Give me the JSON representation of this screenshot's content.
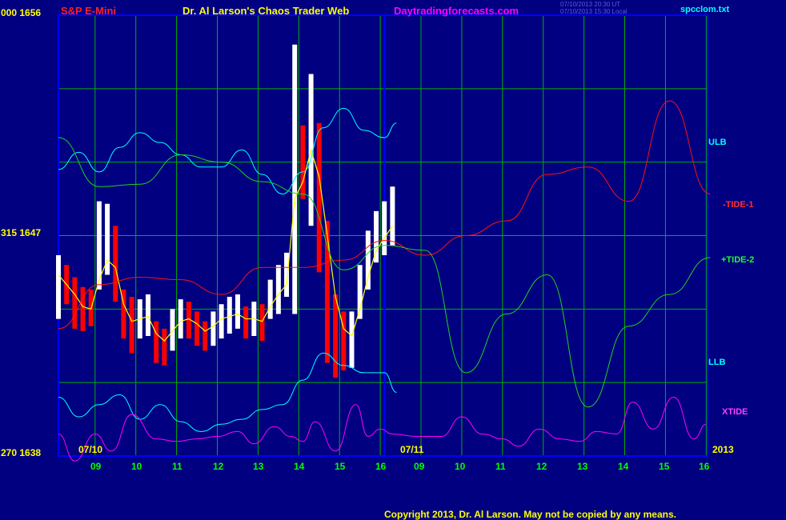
{
  "header": {
    "corner_label": "000  1656",
    "symbol": "S&P E-Mini",
    "site_title": "Dr. Al Larson's Chaos Trader Web",
    "website": "Daytradingforecasts.com",
    "timestamp_1": "07/10/2013 20:30 UT",
    "timestamp_2": "07/10/2013 15:30 Local",
    "filename": "spcclom.txt"
  },
  "footer": {
    "copyright": "Copyright 2013, Dr. Al Larson. May not be copied by any means."
  },
  "colors": {
    "background": "#000080",
    "grid": "#00b000",
    "axis": "#0000ff",
    "tide1": "#ff1010",
    "tide2": "#20d020",
    "band": "#00ffff",
    "xtide": "#ff00ff",
    "bar_up": "#ffffff",
    "bar_down": "#ff0000",
    "average": "#ffff00"
  },
  "chart_data": {
    "type": "line",
    "y_axis": {
      "ticks": [
        {
          "label": "000  1656",
          "value": 1656
        },
        {
          "label": "315  1647",
          "value": 1647
        },
        {
          "label": "270  1638",
          "value": 1638
        }
      ]
    },
    "x_axis": {
      "hour_ticks": [
        "09",
        "10",
        "11",
        "12",
        "13",
        "14",
        "15",
        "16",
        "09",
        "10",
        "11",
        "12",
        "13",
        "14",
        "15",
        "16"
      ],
      "date_labels": [
        "07/10",
        "07/11",
        "2013"
      ]
    },
    "grid": true,
    "series": [
      {
        "name": "ULB",
        "color": "#00ffff",
        "x": [
          0,
          0.5,
          1,
          1.5,
          2,
          2.5,
          3,
          3.5,
          4,
          4.5,
          5,
          5.5,
          6,
          6.5,
          7,
          7.5,
          8,
          8.3
        ],
        "y": [
          1649.7,
          1650.4,
          1649.6,
          1650.6,
          1651.2,
          1650.8,
          1650.3,
          1649.8,
          1649.8,
          1650.5,
          1649.5,
          1648.7,
          1649.6,
          1651.4,
          1652.2,
          1651.3,
          1651.0,
          1651.6
        ]
      },
      {
        "name": "LLB",
        "color": "#00ffff",
        "x": [
          0,
          0.5,
          1,
          1.5,
          2,
          2.5,
          3,
          3.5,
          4,
          4.5,
          5,
          5.5,
          6,
          6.5,
          7,
          7.5,
          8,
          8.3
        ],
        "y": [
          1640.4,
          1639.6,
          1640.1,
          1640.5,
          1639.5,
          1640.1,
          1639.4,
          1639.0,
          1639.3,
          1639.5,
          1639.9,
          1640.1,
          1641.1,
          1642.2,
          1641.7,
          1641.4,
          1641.4,
          1640.6
        ]
      },
      {
        "name": "-TIDE-1",
        "color": "#ff1010",
        "x": [
          0,
          1,
          2,
          3,
          4,
          5,
          6,
          7,
          8,
          9,
          10,
          11,
          12,
          13,
          14,
          15,
          16
        ],
        "y": [
          1643.2,
          1645.0,
          1645.3,
          1645.2,
          1644.6,
          1645.7,
          1645.7,
          1646.0,
          1646.8,
          1646.2,
          1647.0,
          1647.6,
          1649.5,
          1649.8,
          1648.4,
          1652.5,
          1648.7
        ]
      },
      {
        "name": "+TIDE-2",
        "color": "#20d020",
        "x": [
          0,
          1,
          2,
          3,
          4,
          5,
          6,
          7,
          8,
          9,
          10,
          11,
          12,
          13,
          14,
          15,
          16
        ],
        "y": [
          1651.0,
          1649.0,
          1649.1,
          1650.3,
          1650.0,
          1649.2,
          1648.7,
          1645.6,
          1646.6,
          1646.4,
          1641.4,
          1643.8,
          1645.4,
          1640.0,
          1643.3,
          1644.6,
          1646.1
        ]
      },
      {
        "name": "XTIDE",
        "color": "#ff00ff",
        "x": [
          0,
          0.4,
          0.9,
          1.3,
          1.8,
          2.4,
          2.9,
          3.4,
          3.9,
          4.4,
          4.8,
          5.3,
          5.7,
          6.0,
          6.3,
          6.8,
          7.3,
          7.6,
          7.9,
          8.2,
          8.8,
          9.4,
          9.9,
          10.4,
          10.9,
          11.3,
          11.8,
          12.3,
          12.8,
          13.2,
          13.7,
          14.1,
          14.6,
          15.1,
          15.6,
          15.9
        ],
        "y": [
          1638.9,
          1637.8,
          1638.9,
          1638.2,
          1639.7,
          1638.7,
          1638.6,
          1638.7,
          1638.8,
          1639.0,
          1638.5,
          1639.2,
          1638.8,
          1638.6,
          1639.4,
          1638.2,
          1640.1,
          1638.8,
          1639.1,
          1638.9,
          1638.8,
          1638.8,
          1639.6,
          1638.9,
          1638.7,
          1638.4,
          1639.1,
          1638.7,
          1638.6,
          1639.0,
          1638.9,
          1640.2,
          1639.1,
          1640.4,
          1638.7,
          1639.3
        ]
      }
    ],
    "series_labels": [
      "ULB",
      "-TIDE-1",
      "+TIDE-2",
      "LLB",
      "XTIDE"
    ],
    "price_bars": {
      "x": [
        0.0,
        0.2,
        0.4,
        0.6,
        0.8,
        1.0,
        1.2,
        1.4,
        1.6,
        1.8,
        2.0,
        2.2,
        2.4,
        2.6,
        2.8,
        3.0,
        3.2,
        3.4,
        3.6,
        3.8,
        4.0,
        4.2,
        4.4,
        4.6,
        4.8,
        5.0,
        5.2,
        5.4,
        5.6,
        5.8,
        6.0,
        6.2,
        6.4,
        6.6,
        6.8,
        7.0,
        7.2,
        7.4,
        7.6,
        7.8,
        8.0,
        8.2
      ],
      "close": [
        1645.5,
        1645.1,
        1644.8,
        1644.3,
        1644.1,
        1645.6,
        1646.8,
        1646.3,
        1643.8,
        1643.5,
        1643.8,
        1643.9,
        1642.9,
        1642.6,
        1643.3,
        1643.8,
        1643.7,
        1643.3,
        1643.0,
        1643.3,
        1643.7,
        1643.7,
        1643.9,
        1643.5,
        1643.6,
        1643.4,
        1644.4,
        1644.9,
        1645.2,
        1651.4,
        1649.8,
        1652.8,
        1650.8,
        1646.5,
        1643.4,
        1642.4,
        1642.5,
        1644.6,
        1645.8,
        1646.9,
        1647.2,
        1647.8
      ],
      "high": [
        1646.2,
        1645.8,
        1645.3,
        1644.9,
        1644.8,
        1648.4,
        1648.3,
        1647.4,
        1644.8,
        1644.5,
        1644.4,
        1644.6,
        1643.5,
        1643.2,
        1644.0,
        1644.4,
        1644.3,
        1643.9,
        1643.5,
        1643.9,
        1644.2,
        1644.5,
        1644.6,
        1644.1,
        1644.3,
        1644.2,
        1645.2,
        1645.8,
        1646.3,
        1654.8,
        1651.5,
        1653.6,
        1651.6,
        1647.6,
        1644.6,
        1643.9,
        1643.9,
        1645.8,
        1647.2,
        1648.0,
        1648.4,
        1649.0
      ],
      "low": [
        1643.6,
        1644.2,
        1643.2,
        1643.1,
        1643.3,
        1644.8,
        1645.4,
        1644.3,
        1642.8,
        1642.2,
        1642.8,
        1642.9,
        1641.8,
        1641.7,
        1642.3,
        1642.8,
        1642.8,
        1642.5,
        1642.3,
        1642.5,
        1642.8,
        1643.0,
        1643.2,
        1642.8,
        1642.9,
        1642.7,
        1643.6,
        1643.8,
        1644.5,
        1643.8,
        1648.5,
        1647.4,
        1645.5,
        1641.8,
        1641.2,
        1641.5,
        1641.6,
        1643.6,
        1644.8,
        1645.9,
        1646.2,
        1646.6
      ],
      "average": [
        1645.4,
        1645.0,
        1644.6,
        1644.1,
        1644.0,
        1645.2,
        1646.0,
        1645.7,
        1644.2,
        1643.5,
        1643.6,
        1643.7,
        1643.0,
        1642.7,
        1643.1,
        1643.5,
        1643.6,
        1643.4,
        1643.1,
        1643.3,
        1643.6,
        1643.7,
        1643.8,
        1643.6,
        1643.6,
        1643.5,
        1644.1,
        1644.6,
        1645.0,
        1648.5,
        1649.2,
        1650.5,
        1649.4,
        1647.0,
        1644.5,
        1643.2,
        1642.9,
        1644.0,
        1645.3,
        1646.4,
        1646.9,
        1647.4
      ]
    }
  }
}
